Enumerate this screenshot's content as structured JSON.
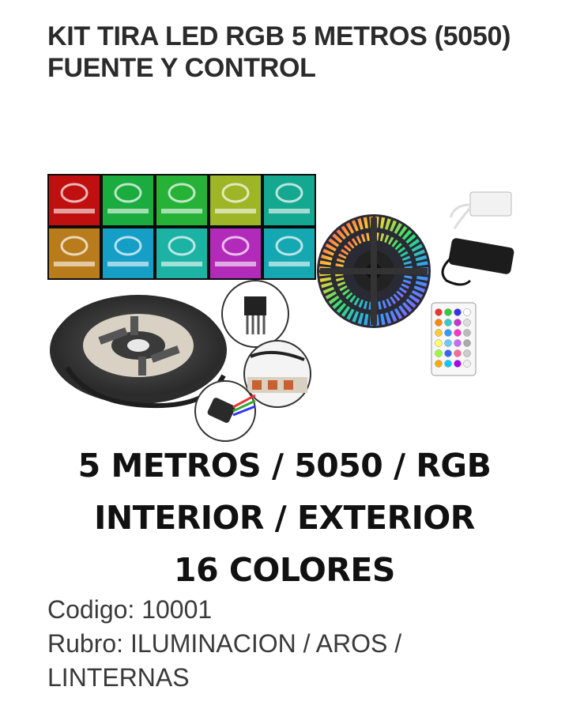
{
  "product": {
    "title": "KIT TIRA LED RGB 5 METROS (5050) FUENTE Y CONTROL",
    "image_lines": [
      "5 METROS / 5050 / RGB",
      "INTERIOR / EXTERIOR",
      "16 COLORES"
    ],
    "codigo": "Codigo: 10001",
    "rubro": "Rubro: ILUMINACION / AROS / LINTERNAS"
  },
  "colors": {
    "swatches": [
      "#e01010",
      "#1fc94a",
      "#2ad040",
      "#b8d42a",
      "#18c4a8",
      "#d89020",
      "#18b8e8",
      "#20d0c0",
      "#d030d8",
      "#18c4d0"
    ]
  }
}
